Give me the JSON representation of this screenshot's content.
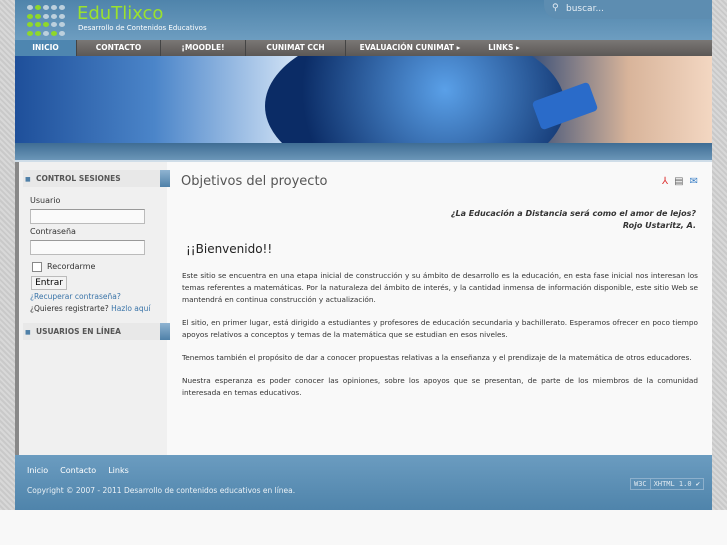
{
  "header": {
    "site_name": "EduTlixco",
    "tagline": "Desarrollo de Contenidos Educativos",
    "search_placeholder": "buscar..."
  },
  "nav": [
    {
      "label": "INICIO",
      "active": true
    },
    {
      "label": "CONTACTO"
    },
    {
      "label": "¡MOODLE!"
    },
    {
      "label": "CUNIMAT CCH"
    },
    {
      "label": "EVALUACIÓN CUNIMAT ▸"
    },
    {
      "label": "LINKS ▸"
    }
  ],
  "sidebar": {
    "login_title": "CONTROL SESIONES",
    "username_label": "Usuario",
    "password_label": "Contraseña",
    "remember_label": "Recordarme",
    "submit_label": "Entrar",
    "forgot_link": "¿Recuperar contraseña?",
    "register_text": "¿Quieres registrarte?",
    "register_link": "Hazlo aquí",
    "online_title": "USUARIOS EN LÍNEA"
  },
  "main": {
    "title": "Objetivos del proyecto",
    "quote": "¿La Educación a Distancia será como el amor de lejos?",
    "quote_author": "Rojo Ustaritz, A.",
    "welcome": "¡¡Bienvenido!!",
    "paragraphs": [
      "Este sitio se encuentra en una etapa inicial de construcción y su ámbito de desarrollo es la educación,  en esta fase inicial nos interesan los temas referentes a matemáticas. Por la naturaleza del ámbito de interés, y la cantidad inmensa de información disponible, este sitio Web se mantendrá en continua construcción y actualización.",
      "El sitio, en primer lugar, está dirigido a estudiantes y profesores de educación secundaria y bachillerato. Esperamos ofrecer en poco tiempo apoyos relativos a conceptos y temas de la matemática que se estudian en esos niveles.",
      "Tenemos también el propósito de dar a conocer propuestas relativas a la enseñanza y el prendizaje de la matemática de otros educadores.",
      "Nuestra esperanza es poder conocer las opiniones, sobre los apoyos que se presentan, de parte de los miembros de la comunidad interesada en temas educativos."
    ]
  },
  "footer": {
    "links": [
      "Inicio",
      "Contacto",
      "Links"
    ],
    "copyright": "Copyright © 2007 - 2011 Desarrollo de contenidos educativos en línea.",
    "badge_left": "W3C",
    "badge_right": "XHTML 1.0 ✔"
  }
}
